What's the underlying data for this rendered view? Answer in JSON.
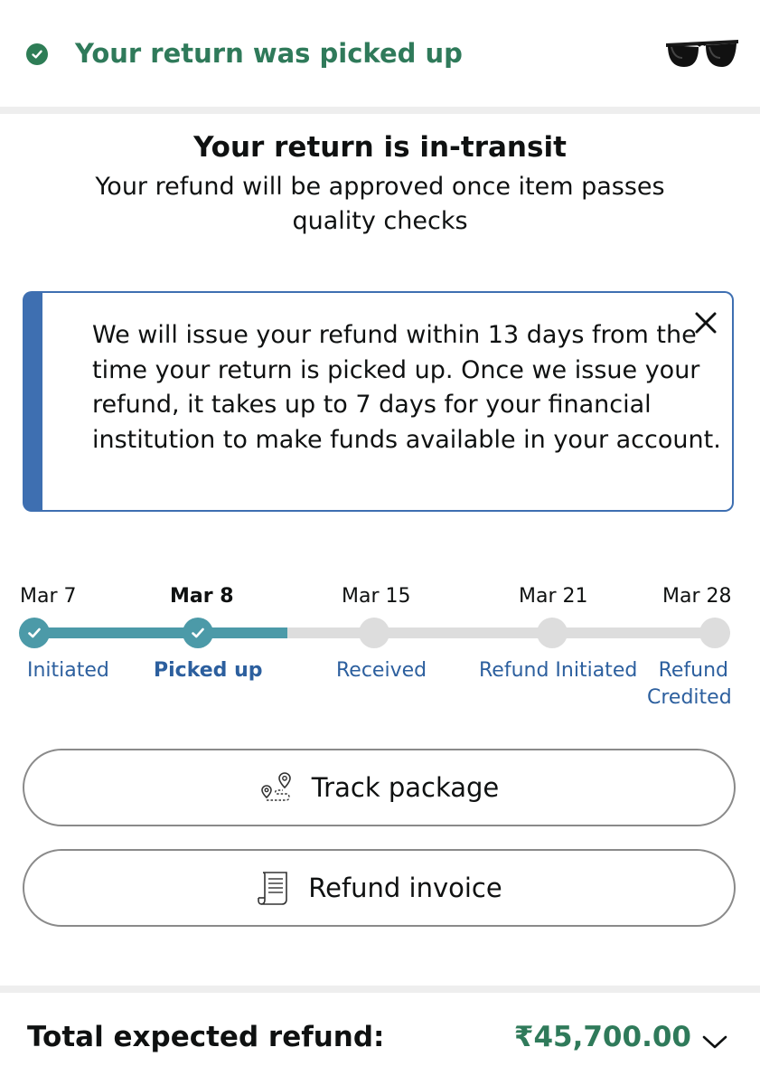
{
  "status": {
    "text": "Your return was picked up",
    "icon": "check-circle-icon",
    "color": "#2f7a5a"
  },
  "product": {
    "icon": "sunglasses-thumbnail"
  },
  "headline": "Your return is in-transit",
  "subline": "Your refund will be approved once item passes quality checks",
  "info_box": {
    "text": "We will issue your refund within 13 days from the time your return is picked up. Once we issue your refund, it takes up to 7 days for your financial institution to make funds available in your account.",
    "close_icon": "close-icon",
    "accent": "#3e6fb1"
  },
  "timeline": {
    "progress_color": "#4c9aa8",
    "pending_color": "#dddddd",
    "steps": [
      {
        "date": "Mar 7",
        "label": "Initiated",
        "state": "done",
        "current": false
      },
      {
        "date": "Mar 8",
        "label": "Picked up",
        "state": "done",
        "current": true
      },
      {
        "date": "Mar 15",
        "label": "Received",
        "state": "pending",
        "current": false
      },
      {
        "date": "Mar 21",
        "label": "Refund Initiated",
        "state": "pending",
        "current": false
      },
      {
        "date": "Mar 28",
        "label": "Refund Credited",
        "state": "pending",
        "current": false
      }
    ]
  },
  "buttons": {
    "track": {
      "label": "Track package",
      "icon": "route-map-pin-icon"
    },
    "invoice": {
      "label": "Refund invoice",
      "icon": "invoice-document-icon"
    }
  },
  "refund": {
    "label": "Total expected refund:",
    "amount": "₹45,700.00",
    "amount_color": "#2f7a5a",
    "expand_icon": "chevron-down-icon"
  }
}
